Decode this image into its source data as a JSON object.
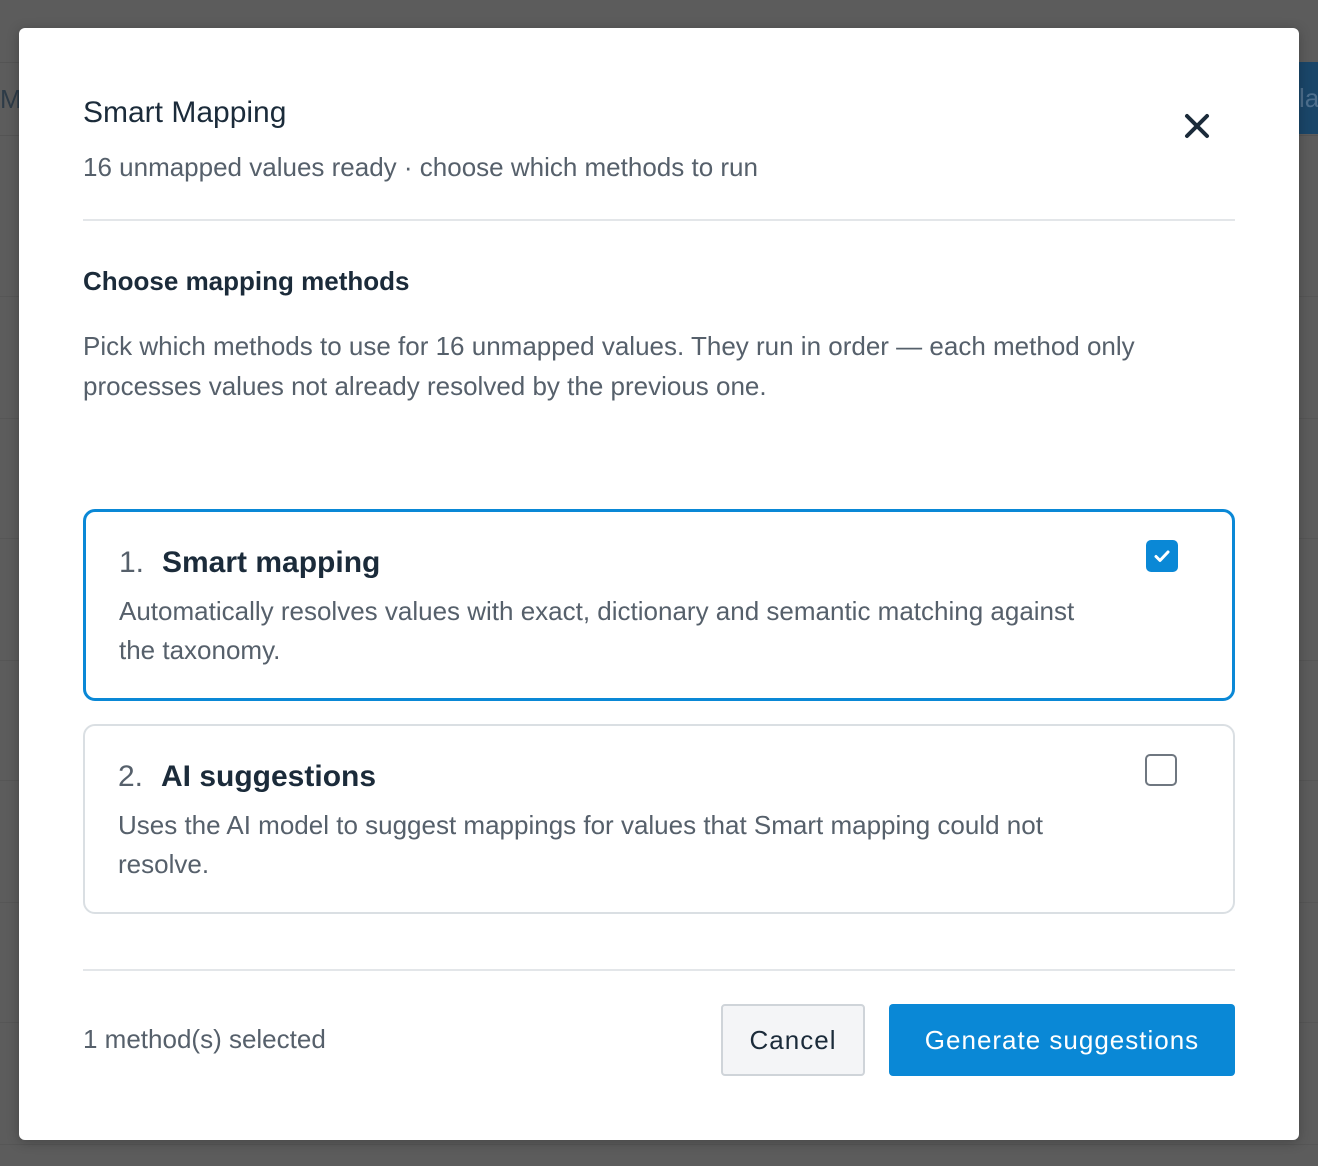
{
  "background": {
    "left_fragment": "Ma",
    "right_fragment": "la"
  },
  "modal": {
    "title": "Smart Mapping",
    "subtitle": "16 unmapped values ready · choose which methods to run",
    "close_icon": "close-icon",
    "section_title": "Choose mapping methods",
    "section_description": "Pick which methods to use for 16 unmapped values. They run in order — each method only processes values not already resolved by the previous one.",
    "methods": [
      {
        "number": "1.",
        "name": "Smart mapping",
        "description": "Automatically resolves values with exact, dictionary and semantic matching against the taxonomy.",
        "checked": true
      },
      {
        "number": "2.",
        "name": "AI suggestions",
        "description": "Uses the AI model to suggest mappings for values that Smart mapping could not resolve.",
        "checked": false
      }
    ],
    "footer": {
      "selected_count": "1 method(s) selected",
      "cancel_label": "Cancel",
      "generate_label": "Generate suggestions"
    }
  },
  "colors": {
    "accent": "#0a88d6",
    "title_text": "#1b2b3a",
    "muted_text": "#56606b",
    "overlay": "#5c5c5c"
  }
}
